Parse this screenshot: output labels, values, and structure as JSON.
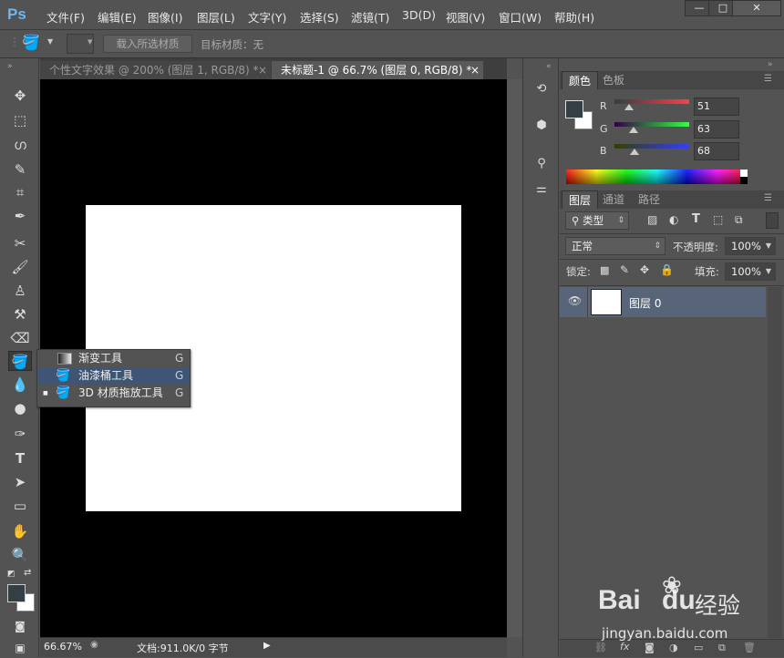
{
  "app": {
    "logo": "Ps"
  },
  "menubar": {
    "items": [
      "文件(F)",
      "编辑(E)",
      "图像(I)",
      "图层(L)",
      "文字(Y)",
      "选择(S)",
      "滤镜(T)",
      "3D(D)",
      "视图(V)",
      "窗口(W)",
      "帮助(H)"
    ]
  },
  "window_controls": {
    "minimize": "—",
    "maximize": "□",
    "close": "✕"
  },
  "options_bar": {
    "load_button": "载入所选材质",
    "target_label": "目标材质：无"
  },
  "document_tabs": [
    {
      "label": "个性文字效果 @ 200% (图层 1, RGB/8) *",
      "close": "×",
      "active": false
    },
    {
      "label": "未标题-1 @ 66.7% (图层 0, RGB/8) *",
      "close": "×",
      "active": true
    }
  ],
  "flyout": {
    "items": [
      {
        "label": "渐变工具",
        "key": "G",
        "active": false,
        "current": false
      },
      {
        "label": "油漆桶工具",
        "key": "G",
        "active": true,
        "current": false
      },
      {
        "label": "3D 材质拖放工具",
        "key": "G",
        "active": false,
        "current": true
      }
    ],
    "current_marker": "■"
  },
  "status_bar": {
    "zoom": "66.67%",
    "doc_info": "文档:911.0K/0 字节"
  },
  "color_panel": {
    "tabs": [
      "颜色",
      "色板"
    ],
    "channels": [
      {
        "name": "R",
        "value": "51",
        "fraction": 0.2
      },
      {
        "name": "G",
        "value": "63",
        "fraction": 0.25
      },
      {
        "name": "B",
        "value": "68",
        "fraction": 0.27
      }
    ],
    "foreground": "#333f44",
    "background": "#ffffff"
  },
  "layers_panel": {
    "tabs": [
      "图层",
      "通道",
      "路径"
    ],
    "filter_kind": "类型",
    "blend_mode": "正常",
    "opacity_label": "不透明度:",
    "opacity": "100%",
    "lock_label": "锁定:",
    "fill_label": "填充:",
    "fill": "100%",
    "layers": [
      {
        "name": "图层 0",
        "visible": true,
        "selected": true
      }
    ]
  },
  "watermark": {
    "brand": "Bai",
    "brand2": "du",
    "brand3": "经验",
    "url": "jingyan.baidu.com"
  }
}
